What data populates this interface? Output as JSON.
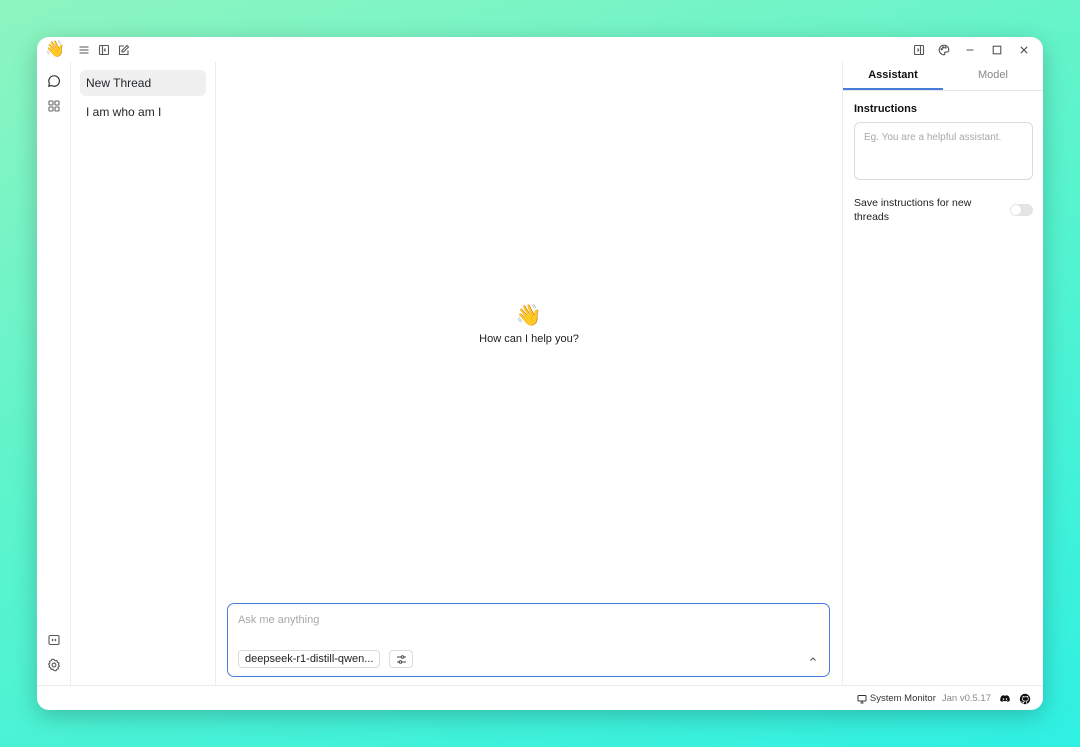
{
  "app": {
    "logo_emoji": "👋"
  },
  "threads": {
    "items": [
      {
        "label": "New Thread",
        "active": true
      },
      {
        "label": "I am who am I",
        "active": false
      }
    ]
  },
  "main": {
    "welcome_emoji": "👋",
    "welcome_text": "How can I help you?",
    "input_placeholder": "Ask me anything",
    "model_label": "deepseek-r1-distill-qwen..."
  },
  "right_panel": {
    "tabs": [
      {
        "label": "Assistant",
        "active": true
      },
      {
        "label": "Model",
        "active": false
      }
    ],
    "instructions_label": "Instructions",
    "instructions_placeholder": "Eg. You are a helpful assistant.",
    "save_instructions_label": "Save instructions for new threads",
    "save_instructions_enabled": false
  },
  "status_bar": {
    "system_monitor": "System Monitor",
    "version": "Jan v0.5.17"
  },
  "colors": {
    "accent": "#4a7cdb",
    "background_gradient_start": "#8ef5c0",
    "background_gradient_end": "#2ff0e2"
  },
  "icons": {
    "titlebar_left": [
      "menu-icon",
      "panel-left-icon",
      "edit-icon"
    ],
    "titlebar_right": [
      "panel-right-icon",
      "palette-icon",
      "minimize-icon",
      "maximize-icon",
      "close-icon"
    ],
    "rail_top": [
      "chat-bubble-icon",
      "grid-icon"
    ],
    "rail_bottom": [
      "terminal-icon",
      "gear-icon"
    ],
    "status": [
      "monitor-icon",
      "discord-icon",
      "github-icon"
    ]
  }
}
